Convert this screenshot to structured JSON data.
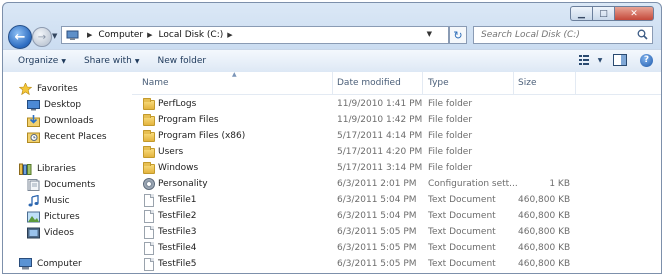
{
  "title_buttons": {
    "minimize": "▁",
    "maximize": "□",
    "close": "✕"
  },
  "address": {
    "breadcrumbs": [
      "Computer",
      "Local Disk (C:)"
    ],
    "search_placeholder": "Search Local Disk (C:)"
  },
  "toolbar": {
    "organize": "Organize",
    "share_with": "Share with",
    "new_folder": "New folder"
  },
  "columns": {
    "name": "Name",
    "date_modified": "Date modified",
    "type": "Type",
    "size": "Size"
  },
  "nav": {
    "favorites": "Favorites",
    "desktop": "Desktop",
    "downloads": "Downloads",
    "recent_places": "Recent Places",
    "libraries": "Libraries",
    "documents": "Documents",
    "music": "Music",
    "pictures": "Pictures",
    "videos": "Videos",
    "computer": "Computer"
  },
  "files": [
    {
      "name": "PerfLogs",
      "date": "11/9/2010 1:41 PM",
      "type": "File folder",
      "size": "",
      "icon": "folder-icon"
    },
    {
      "name": "Program Files",
      "date": "11/9/2010 1:42 PM",
      "type": "File folder",
      "size": "",
      "icon": "folder-icon"
    },
    {
      "name": "Program Files (x86)",
      "date": "5/17/2011 4:14 PM",
      "type": "File folder",
      "size": "",
      "icon": "folder-icon"
    },
    {
      "name": "Users",
      "date": "5/17/2011 4:20 PM",
      "type": "File folder",
      "size": "",
      "icon": "folder-icon"
    },
    {
      "name": "Windows",
      "date": "5/17/2011 3:14 PM",
      "type": "File folder",
      "size": "",
      "icon": "folder-icon"
    },
    {
      "name": "Personality",
      "date": "6/3/2011 2:01 PM",
      "type": "Configuration sett...",
      "size": "1 KB",
      "icon": "config-file-icon"
    },
    {
      "name": "TestFile1",
      "date": "6/3/2011 5:04 PM",
      "type": "Text Document",
      "size": "460,800 KB",
      "icon": "text-file-icon"
    },
    {
      "name": "TestFile2",
      "date": "6/3/2011 5:04 PM",
      "type": "Text Document",
      "size": "460,800 KB",
      "icon": "text-file-icon"
    },
    {
      "name": "TestFile3",
      "date": "6/3/2011 5:05 PM",
      "type": "Text Document",
      "size": "460,800 KB",
      "icon": "text-file-icon"
    },
    {
      "name": "TestFile4",
      "date": "6/3/2011 5:05 PM",
      "type": "Text Document",
      "size": "460,800 KB",
      "icon": "text-file-icon"
    },
    {
      "name": "TestFile5",
      "date": "6/3/2011 5:05 PM",
      "type": "Text Document",
      "size": "460,800 KB",
      "icon": "text-file-icon"
    }
  ]
}
